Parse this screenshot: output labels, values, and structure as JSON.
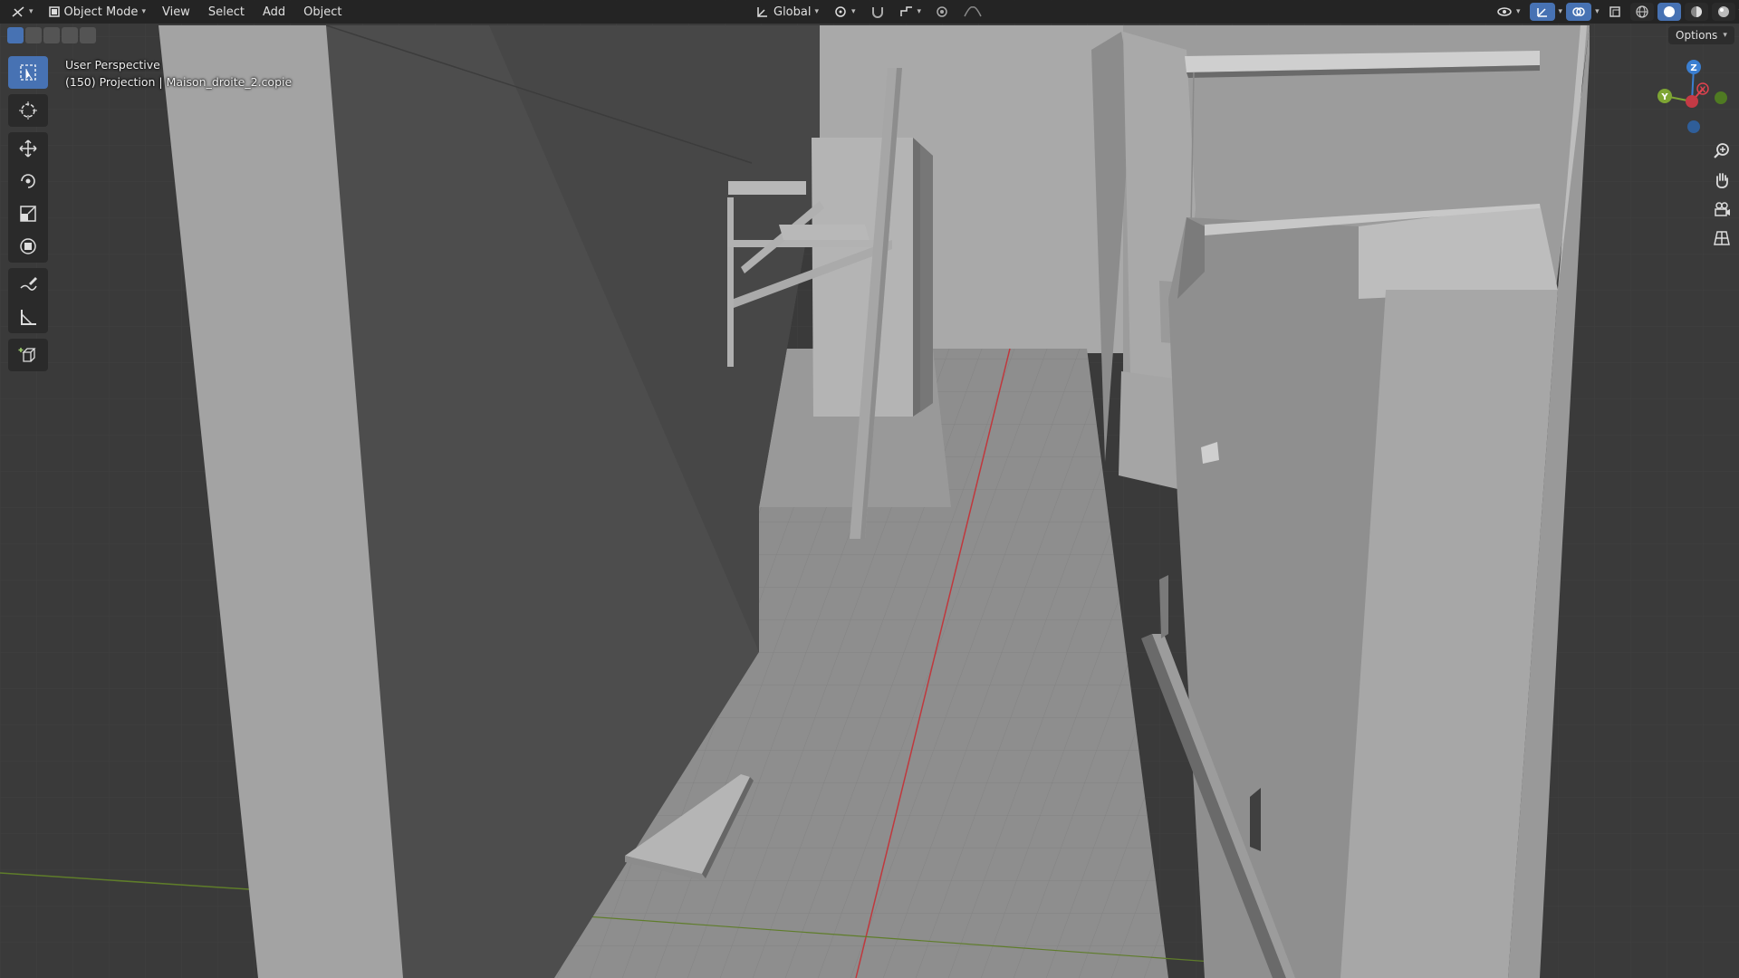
{
  "header": {
    "mode_label": "Object Mode",
    "menus": [
      "View",
      "Select",
      "Add",
      "Object"
    ],
    "transform_orientation": "Global"
  },
  "viewport": {
    "view_name": "User Perspective",
    "frame": "(150)",
    "projection": "Projection",
    "object_name": "Maison_droite_2.copie",
    "options_label": "Options"
  },
  "gizmo": {
    "z_label": "Z",
    "y_label": "Y",
    "x_label": "X",
    "colors": {
      "x": "#e0424f",
      "y": "#7ea534",
      "z": "#3b7fd1"
    }
  },
  "tools": [
    "select-box",
    "cursor",
    "move",
    "rotate",
    "scale",
    "transform",
    "annotate",
    "measure",
    "add-cube"
  ],
  "colors": {
    "accent": "#4772b3",
    "background": "#3a3a3a",
    "header": "#232323",
    "x_axis_line": "#c0383d",
    "y_axis_line": "#5f7d2a"
  }
}
